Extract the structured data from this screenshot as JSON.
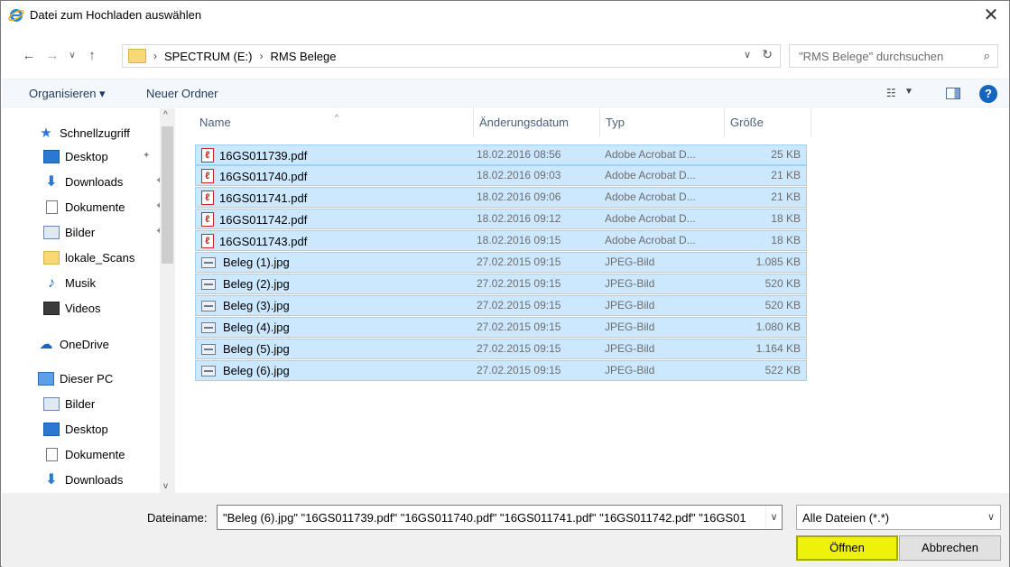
{
  "window": {
    "title": "Datei zum Hochladen auswählen",
    "close_glyph": "✕"
  },
  "address": {
    "breadcrumbs": [
      "SPECTRUM (E:)",
      "RMS Belege"
    ],
    "search_placeholder": "\"RMS Belege\" durchsuchen"
  },
  "toolbar": {
    "organize_label": "Organisieren ▾",
    "new_folder_label": "Neuer Ordner"
  },
  "sidebar": {
    "items": [
      {
        "label": "Schnellzugriff",
        "icon": "star-icon"
      },
      {
        "label": "Desktop",
        "icon": "desktop-icon",
        "pinned": true
      },
      {
        "label": "Downloads",
        "icon": "download-icon",
        "pinned": true
      },
      {
        "label": "Dokumente",
        "icon": "document-icon",
        "pinned": true
      },
      {
        "label": "Bilder",
        "icon": "pictures-icon",
        "pinned": true
      },
      {
        "label": "lokale_Scans",
        "icon": "folder-icon"
      },
      {
        "label": "Musik",
        "icon": "music-icon"
      },
      {
        "label": "Videos",
        "icon": "video-icon"
      },
      {
        "label": "OneDrive",
        "icon": "onedrive-icon"
      },
      {
        "label": "Dieser PC",
        "icon": "pc-icon"
      },
      {
        "label": "Bilder",
        "icon": "pictures-icon"
      },
      {
        "label": "Desktop",
        "icon": "desktop-icon"
      },
      {
        "label": "Dokumente",
        "icon": "document-icon"
      },
      {
        "label": "Downloads",
        "icon": "download-icon"
      }
    ]
  },
  "filelist": {
    "columns": [
      "Name",
      "Änderungsdatum",
      "Typ",
      "Größe"
    ],
    "rows": [
      {
        "name": "16GS011739.pdf",
        "date": "18.02.2016 08:56",
        "type": "Adobe Acrobat D...",
        "size": "25 KB",
        "kind": "pdf"
      },
      {
        "name": "16GS011740.pdf",
        "date": "18.02.2016 09:03",
        "type": "Adobe Acrobat D...",
        "size": "21 KB",
        "kind": "pdf"
      },
      {
        "name": "16GS011741.pdf",
        "date": "18.02.2016 09:06",
        "type": "Adobe Acrobat D...",
        "size": "21 KB",
        "kind": "pdf"
      },
      {
        "name": "16GS011742.pdf",
        "date": "18.02.2016 09:12",
        "type": "Adobe Acrobat D...",
        "size": "18 KB",
        "kind": "pdf"
      },
      {
        "name": "16GS011743.pdf",
        "date": "18.02.2016 09:15",
        "type": "Adobe Acrobat D...",
        "size": "18 KB",
        "kind": "pdf"
      },
      {
        "name": "Beleg (1).jpg",
        "date": "27.02.2015 09:15",
        "type": "JPEG-Bild",
        "size": "1.085 KB",
        "kind": "jpg"
      },
      {
        "name": "Beleg (2).jpg",
        "date": "27.02.2015 09:15",
        "type": "JPEG-Bild",
        "size": "520 KB",
        "kind": "jpg"
      },
      {
        "name": "Beleg (3).jpg",
        "date": "27.02.2015 09:15",
        "type": "JPEG-Bild",
        "size": "520 KB",
        "kind": "jpg"
      },
      {
        "name": "Beleg (4).jpg",
        "date": "27.02.2015 09:15",
        "type": "JPEG-Bild",
        "size": "1.080 KB",
        "kind": "jpg"
      },
      {
        "name": "Beleg (5).jpg",
        "date": "27.02.2015 09:15",
        "type": "JPEG-Bild",
        "size": "1.164 KB",
        "kind": "jpg"
      },
      {
        "name": "Beleg (6).jpg",
        "date": "27.02.2015 09:15",
        "type": "JPEG-Bild",
        "size": "522 KB",
        "kind": "jpg"
      }
    ]
  },
  "footer": {
    "filename_label": "Dateiname:",
    "filename_value": "\"Beleg (6).jpg\" \"16GS011739.pdf\" \"16GS011740.pdf\" \"16GS011741.pdf\" \"16GS011742.pdf\" \"16GS01",
    "filetype_value": "Alle Dateien (*.*)",
    "open_label": "Öffnen",
    "cancel_label": "Abbrechen"
  },
  "colors": {
    "selection_bg": "#cce8ff",
    "selection_border": "#99d1ff",
    "open_highlight": "#eef20a"
  }
}
